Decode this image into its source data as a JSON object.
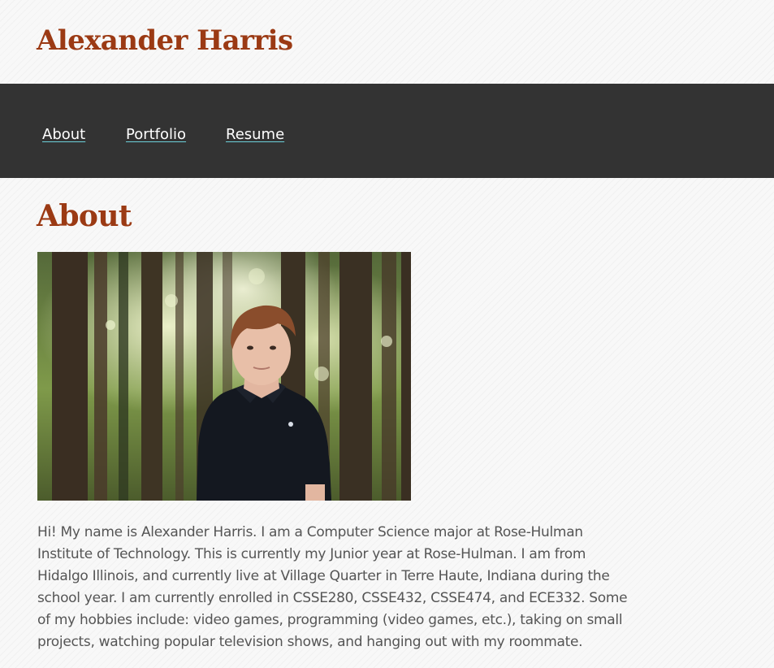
{
  "header": {
    "site_title": "Alexander Harris"
  },
  "nav": {
    "items": [
      {
        "label": "About"
      },
      {
        "label": "Portfolio"
      },
      {
        "label": "Resume"
      }
    ]
  },
  "about": {
    "heading": "About",
    "photo_alt": "Alexander Harris portrait",
    "bio": "Hi! My name is Alexander Harris. I am a Computer Science major at Rose-Hulman Institute of Technology. This is currently my Junior year at Rose-Hulman. I am from Hidalgo Illinois, and currently live at Village Quarter in Terre Haute, Indiana during the school year. I am currently enrolled in CSSE280, CSSE432, CSSE474, and ECE332. Some of my hobbies include: video games, programming (video games, etc.), taking on small projects, watching popular television shows, and hanging out with my roommate."
  },
  "colors": {
    "title_accent": "#9b3a14",
    "nav_background": "#333333",
    "nav_link": "#ffffff",
    "nav_underline": "#6ccfd9",
    "body_text": "#555555"
  }
}
